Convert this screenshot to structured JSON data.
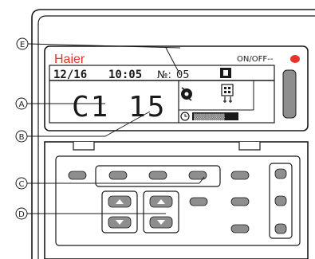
{
  "brand": {
    "name": "Haier",
    "color": "#e8332a"
  },
  "power": {
    "label": "ON/OFF--",
    "led_color": "#e8332a"
  },
  "lcd": {
    "date": "12/16",
    "time": "10:05",
    "number_prefix": "№:",
    "number_value": "05",
    "error_letter": "C",
    "error_digits": "1 15",
    "error_display": "C1 15",
    "timer_bar_label": "▒▒▒▒▒▒▒▒"
  },
  "callouts": {
    "a": "A",
    "b": "B",
    "c": "C",
    "d": "D",
    "e": "E"
  },
  "icons": {
    "header_square": "square-icon",
    "fan": "fan-icon",
    "mode": "mode-grid-icon",
    "clock": "clock-icon"
  },
  "colors": {
    "ink": "#1a1a1a",
    "button": "#8e8e8e",
    "panel": "#ffffff"
  }
}
